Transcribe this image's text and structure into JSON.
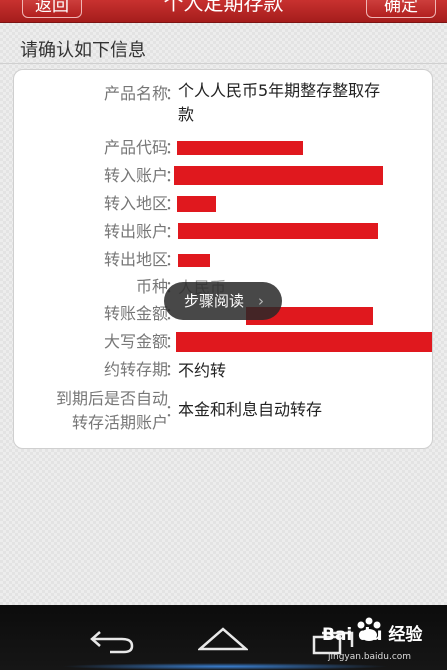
{
  "header": {
    "back_label": "返回",
    "title": "个人定期存款",
    "confirm_label": "确定"
  },
  "section_heading": "请确认如下信息",
  "form": {
    "colon": "：",
    "rows": [
      {
        "label": "产品名称",
        "value": "个人人民币5年期整存整取存",
        "value_line2": "款"
      },
      {
        "label": "产品代码"
      },
      {
        "label": "转入账户"
      },
      {
        "label": "转入地区"
      },
      {
        "label": "转出账户"
      },
      {
        "label": "转出地区"
      },
      {
        "label": "币种",
        "value": "人民币"
      },
      {
        "label": "转账金额"
      },
      {
        "label": "大写金额"
      },
      {
        "label": "约转存期",
        "value": "不约转"
      },
      {
        "label": "到期后是否自动",
        "label_line2": "转存活期账户",
        "value": "本金和利息自动转存"
      }
    ]
  },
  "toast": {
    "label": "步骤阅读",
    "chevron": "›"
  },
  "watermark": {
    "brand": "Bai du 经验",
    "url": "jingyan.baidu.com"
  },
  "colors": {
    "accent": "#c0282a",
    "redaction": "#e0181e"
  },
  "icons": [
    "back-arrow-icon",
    "home-icon",
    "recent-apps-icon",
    "paw-icon",
    "chevron-right-icon"
  ]
}
